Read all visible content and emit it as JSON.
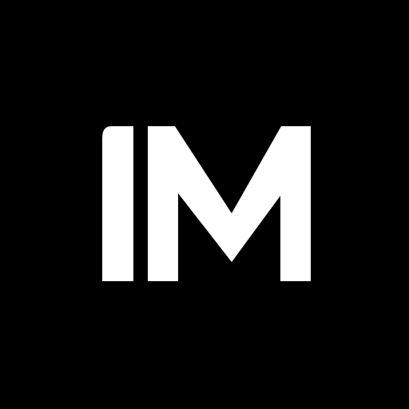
{
  "logo": {
    "text": "IM",
    "foreground_color": "#ffffff",
    "background_color": "#000000"
  }
}
